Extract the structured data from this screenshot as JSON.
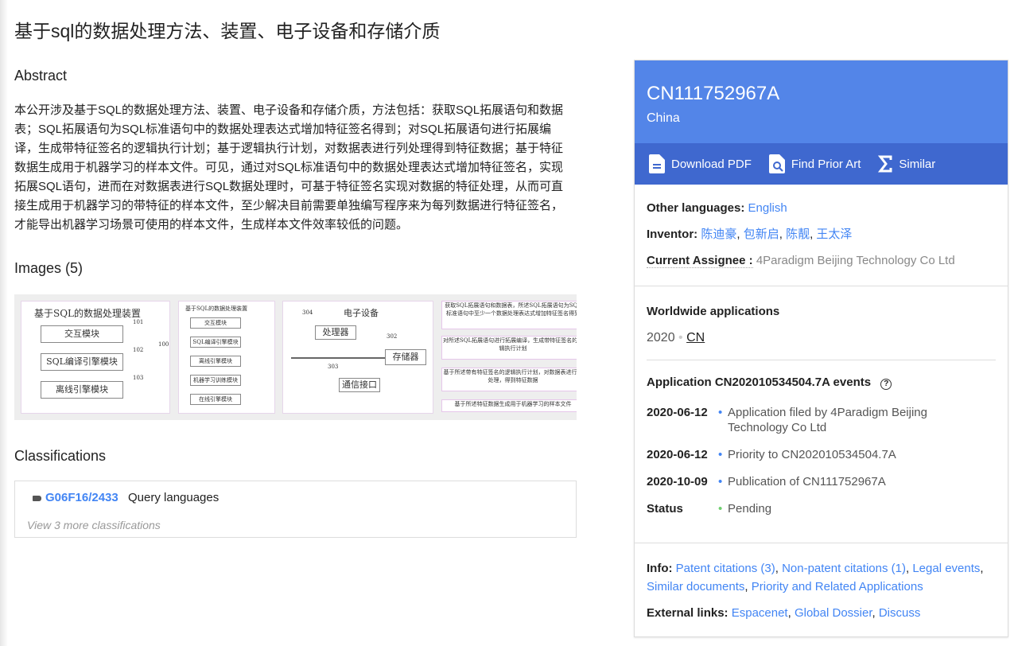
{
  "title": "基于sql的数据处理方法、装置、电子设备和存储介质",
  "abstract": {
    "heading": "Abstract",
    "text": "本公开涉及基于SQL的数据处理方法、装置、电子设备和存储介质，方法包括：获取SQL拓展语句和数据表；SQL拓展语句为SQL标准语句中的数据处理表达式增加特征签名得到；对SQL拓展语句进行拓展编译，生成带特征签名的逻辑执行计划；基于逻辑执行计划，对数据表进行列处理得到特征数据；基于特征数据生成用于机器学习的样本文件。可见，通过对SQL标准语句中的数据处理表达式增加特征签名，实现拓展SQL语句，进而在对数据表进行SQL数据处理时，可基于特征签名实现对数据的特征处理，从而可直接生成用于机器学习的带特征的样本文件，至少解决目前需要单独编写程序来为每列数据进行特征签名，才能导出机器学习场景可使用的样本文件，生成样本文件效率较低的问题。"
  },
  "images": {
    "heading": "Images (5)",
    "thumbs": [
      {
        "title": "基于SQL的数据处理装置",
        "boxes": [
          "交互模块",
          "SQL编译引擎模块",
          "离线引擎模块"
        ],
        "refs": [
          "101",
          "102",
          "103",
          "100"
        ]
      },
      {
        "title": "基于SQL的数据处理装置",
        "boxes": [
          "交互模块",
          "SQL编译引擎模块",
          "离线引擎模块",
          "机器学习训练模块",
          "在线引擎模块"
        ]
      },
      {
        "title": "电子设备",
        "boxes": [
          "处理器",
          "存储器",
          "通信接口"
        ],
        "refs": [
          "304",
          "302",
          "303"
        ]
      },
      {
        "boxes": [
          "获取SQL拓展语句和数据表，所述SQL拓展语句为SQL标准语句中至少一个数据处理表达式增加特征签名得到",
          "对所述SQL拓展语句进行拓展编译，生成带特征签名的逻辑执行计划",
          "基于所述带有特征签名的逻辑执行计划，对数据表进行列处理，得到特征数据",
          "基于所述特征数据生成用于机器学习的样本文件"
        ]
      }
    ]
  },
  "classifications": {
    "heading": "Classifications",
    "code": "G06F16/2433",
    "desc": "Query languages",
    "more": "View 3 more classifications"
  },
  "panel": {
    "number": "CN111752967A",
    "country": "China",
    "actions": [
      {
        "label": "Download PDF",
        "icon": "document-icon"
      },
      {
        "label": "Find Prior Art",
        "icon": "search-document-icon"
      },
      {
        "label": "Similar",
        "icon": "sigma-icon"
      }
    ],
    "other_languages_label": "Other languages:",
    "other_languages": "English",
    "inventor_label": "Inventor:",
    "inventors": [
      "陈迪豪",
      "包新启",
      "陈靓",
      "王太泽"
    ],
    "assignee_label": "Current Assignee :",
    "assignee": "4Paradigm Beijing Technology Co Ltd",
    "worldwide_heading": "Worldwide applications",
    "ww_year": "2020",
    "ww_country": "CN",
    "events_heading": "Application CN202010534504.7A events",
    "events": [
      {
        "date": "2020-06-12",
        "text": "Application filed by 4Paradigm Beijing Technology Co Ltd"
      },
      {
        "date": "2020-06-12",
        "text": "Priority to CN202010534504.7A"
      },
      {
        "date": "2020-10-09",
        "text": "Publication of CN111752967A"
      }
    ],
    "status_label": "Status",
    "status": "Pending",
    "info_label": "Info:",
    "info_links": [
      "Patent citations (3)",
      "Non-patent citations (1)",
      "Legal events",
      "Similar documents",
      "Priority and Related Applications"
    ],
    "external_label": "External links:",
    "external_links": [
      "Espacenet",
      "Global Dossier",
      "Discuss"
    ],
    "colors": {
      "header": "#5385e8",
      "bar": "#3f68cf",
      "link": "#4285f4",
      "pending": "#6fcf6f"
    }
  }
}
